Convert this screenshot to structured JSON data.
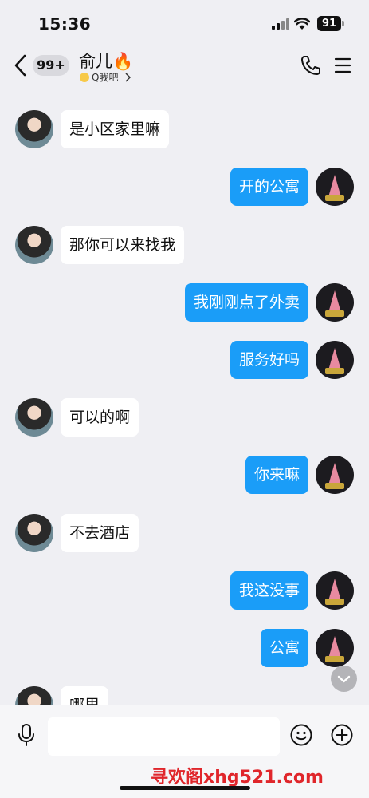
{
  "status_bar": {
    "time": "15:36",
    "battery": "91"
  },
  "header": {
    "unread_count": "99+",
    "contact_name": "俞儿🔥",
    "contact_sub": "Q我吧",
    "back_icon": "chevron-left-icon",
    "phone_icon": "phone-icon",
    "menu_icon": "hamburger-menu-icon"
  },
  "messages": [
    {
      "side": "in",
      "text": "是小区家里嘛"
    },
    {
      "side": "out",
      "text": "开的公寓"
    },
    {
      "side": "in",
      "text": "那你可以来找我"
    },
    {
      "side": "out",
      "text": "我刚刚点了外卖"
    },
    {
      "side": "out",
      "text": "服务好吗"
    },
    {
      "side": "in",
      "text": "可以的啊"
    },
    {
      "side": "out",
      "text": "你来嘛"
    },
    {
      "side": "in",
      "text": "不去酒店"
    },
    {
      "side": "out",
      "text": "我这没事"
    },
    {
      "side": "out",
      "text": "公寓"
    },
    {
      "side": "in",
      "text": "哪里"
    }
  ],
  "input_bar": {
    "placeholder": "",
    "watermark": "寻欢阁xhg521.com"
  },
  "colors": {
    "background": "#efeff3",
    "outgoing_bubble": "#1a9df8",
    "incoming_bubble": "#ffffff",
    "watermark": "#e0262b"
  }
}
